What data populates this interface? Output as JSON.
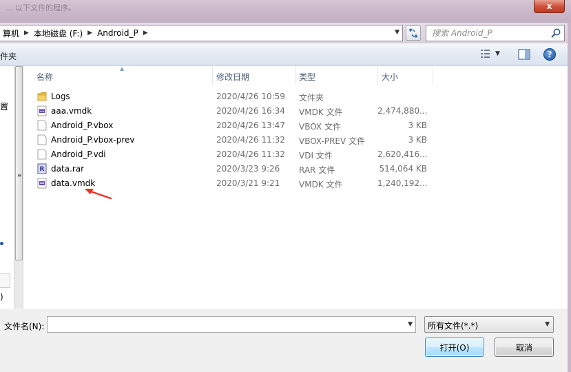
{
  "titlebar": {
    "faded_text": "... 以下文件的程序。",
    "close_glyph": "x"
  },
  "address": {
    "crumbs": [
      "算机",
      "本地磁盘 (F:)",
      "Android_P"
    ],
    "search_placeholder": "搜索 Android_P"
  },
  "toolbar": {
    "new_folder_fragment": "件夹"
  },
  "nav": {
    "fragments": [
      "置",
      "",
      "",
      ")"
    ]
  },
  "columns": {
    "name": "名称",
    "date": "修改日期",
    "type": "类型",
    "size": "大小"
  },
  "files": [
    {
      "name": "Logs",
      "date": "2020/4/26 10:59",
      "type": "文件夹",
      "size": "",
      "icon": "folder-icon"
    },
    {
      "name": "aaa.vmdk",
      "date": "2020/4/26 16:34",
      "type": "VMDK 文件",
      "size": "2,474,880...",
      "icon": "vmdk-file-icon"
    },
    {
      "name": "Android_P.vbox",
      "date": "2020/4/26 13:47",
      "type": "VBOX 文件",
      "size": "3 KB",
      "icon": "blank-file-icon"
    },
    {
      "name": "Android_P.vbox-prev",
      "date": "2020/4/26 11:32",
      "type": "VBOX-PREV 文件",
      "size": "3 KB",
      "icon": "blank-file-icon"
    },
    {
      "name": "Android_P.vdi",
      "date": "2020/4/26 11:32",
      "type": "VDI 文件",
      "size": "2,620,416...",
      "icon": "blank-file-icon"
    },
    {
      "name": "data.rar",
      "date": "2020/3/23 9:26",
      "type": "RAR 文件",
      "size": "514,064 KB",
      "icon": "rar-file-icon"
    },
    {
      "name": "data.vmdk",
      "date": "2020/3/21 9:21",
      "type": "VMDK 文件",
      "size": "1,240,192...",
      "icon": "vmdk-file-icon"
    }
  ],
  "bottom": {
    "filename_label": "文件名(N):",
    "filename_value": "",
    "filter_value": "所有文件(*.*)",
    "open_label": "打开(O)",
    "cancel_label": "取消"
  },
  "colors": {
    "annotation_arrow": "#e8332a",
    "column_header_text": "#4c607a"
  }
}
